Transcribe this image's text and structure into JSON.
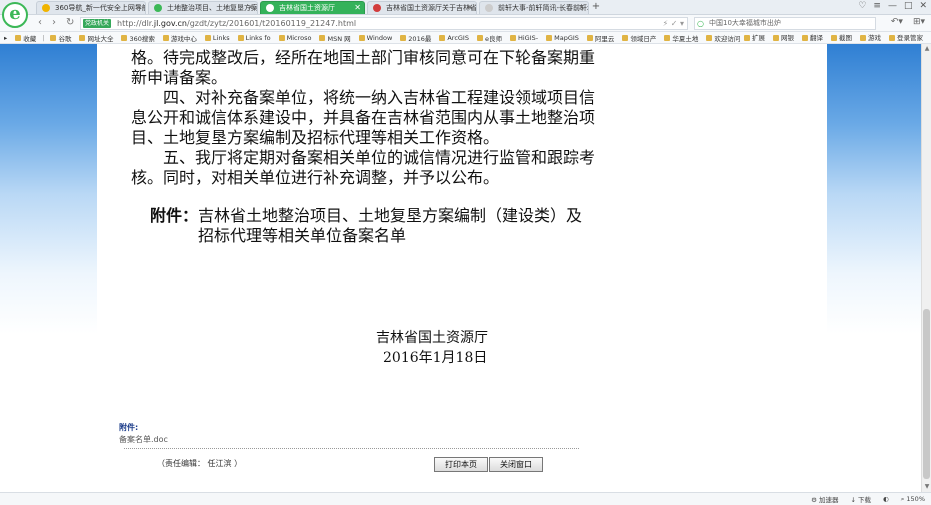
{
  "tabs": [
    {
      "label": "360导航_新一代安全上网导航",
      "active": false,
      "color": "#f0b400"
    },
    {
      "label": "土地整治项目、土地复垦方案编制",
      "active": false,
      "color": "#3cb857"
    },
    {
      "label": "吉林省国土资源厅",
      "active": true,
      "color": "#ffffff"
    },
    {
      "label": "吉林省国土资源厅关于吉林省土",
      "active": false,
      "color": "#d23c3c"
    },
    {
      "label": "前轩大事-前轩简讯-长春前轩地",
      "active": false,
      "color": "#cccccc"
    }
  ],
  "nav": {
    "badge": "党政机关",
    "url_prefix": "http://dlr.",
    "url_host": "jl.gov.cn",
    "url_path": "/gzdt/zytz/201601/t20160119_21247.html",
    "search_placeholder": "中国10大幸福城市出炉"
  },
  "bookmarks": [
    "收藏",
    "谷歌",
    "网址大全",
    "360搜索",
    "游戏中心",
    "Links",
    "Links fo",
    "Microso",
    "MSN 网",
    "Window",
    "2016最",
    "ArcGIS",
    "e良师",
    "HiGIS-",
    "MapGIS",
    "阿里云",
    "领域日产",
    "华夏土地",
    "欢迎访问"
  ],
  "bookmarks_right": [
    "扩展",
    "网银",
    "翻译",
    "截图",
    "游戏",
    "登录管家"
  ],
  "document": {
    "lines": [
      "格。待完成整改后，经所在地国土部门审核同意可在下轮备案期重",
      "新申请备案。",
      "　　四、对补充备案单位，将统一纳入吉林省工程建设领域项目信",
      "息公开和诚信体系建设中，并具备在吉林省范围内从事土地整治项",
      "目、土地复垦方案编制及招标代理等相关工作资格。",
      "　　五、我厅将定期对备案相关单位的诚信情况进行监管和跟踪考",
      "核。同时，对相关单位进行补充调整，并予以公布。"
    ],
    "attachment_label": "附件：",
    "attachment_line1": "吉林省土地整治项目、土地复垦方案编制（建设类）及",
    "attachment_line2": "招标代理等相关单位备案名单",
    "signer": "吉林省国土资源厅",
    "date": "2016年1月18日"
  },
  "footer": {
    "attach_title": "附件:",
    "attach_file": "备案名单.doc",
    "editor": "（责任编辑：  任江滨  ）",
    "print_button": "打印本页",
    "close_button": "关闭窗口"
  },
  "status": {
    "accelerator": "加速器",
    "download": "下载",
    "zoom": "150%"
  }
}
